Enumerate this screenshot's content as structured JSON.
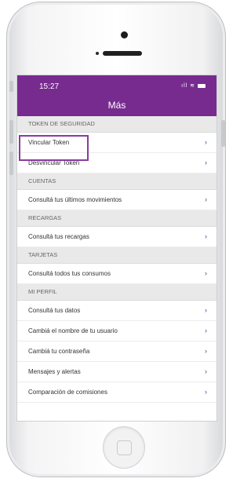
{
  "status": {
    "time": "15:27",
    "signal": "ıll",
    "wifi": "≋"
  },
  "header": {
    "title": "Más"
  },
  "sections": [
    {
      "title": "TOKEN DE SEGURIDAD",
      "items": [
        "Vincular Token",
        "Desvincular Token"
      ]
    },
    {
      "title": "CUENTAS",
      "items": [
        "Consultá tus últimos movimientos"
      ]
    },
    {
      "title": "RECARGAS",
      "items": [
        "Consultá tus recargas"
      ]
    },
    {
      "title": "TARJETAS",
      "items": [
        "Consultá todos tus consumos"
      ]
    },
    {
      "title": "MI PERFIL",
      "items": [
        "Consultá tus datos",
        "Cambiá el nombre de tu usuario",
        "Cambiá tu contraseña",
        "Mensajes y alertas",
        "Comparación de comisiones"
      ]
    }
  ],
  "chevron": "›",
  "colors": {
    "brand": "#772b8f",
    "highlight": "#8a3b9f"
  }
}
